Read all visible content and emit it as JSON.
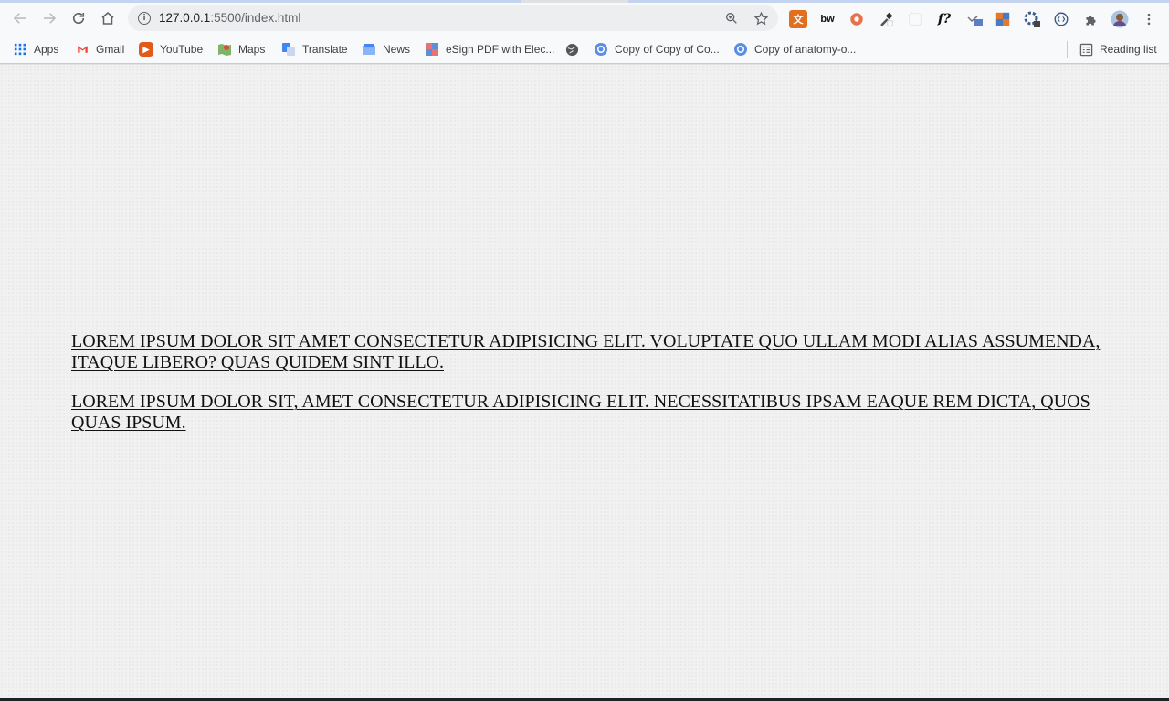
{
  "browser": {
    "url_host": "127.0.0.1",
    "url_rest": ":5500/index.html",
    "extensions": [
      "translate-ext-icon",
      "bw-ext-icon",
      "circle-ext-icon",
      "eyedropper-ext-icon",
      "blank-ext-icon",
      "font-ext-icon",
      "screenshot-ext-icon",
      "grid-ext-icon",
      "settings-ext-icon",
      "code-ext-icon",
      "puzzle-icon",
      "avatar",
      "more-menu-icon"
    ],
    "ext_labels": {
      "bw": "bw",
      "font": "f?"
    }
  },
  "bookmarks": {
    "items": [
      {
        "label": "Apps",
        "icon": "apps-grid-icon",
        "color": "#1a73e8"
      },
      {
        "label": "Gmail",
        "icon": "gmail-icon",
        "color": "#ea4335"
      },
      {
        "label": "YouTube",
        "icon": "youtube-icon",
        "color": "#ff0000"
      },
      {
        "label": "Maps",
        "icon": "maps-icon",
        "color": "#34a853"
      },
      {
        "label": "Translate",
        "icon": "translate-icon",
        "color": "#4285f4"
      },
      {
        "label": "News",
        "icon": "news-icon",
        "color": "#4285f4"
      },
      {
        "label": "eSign PDF with Elec...",
        "icon": "esign-icon",
        "color": "#e57373"
      },
      {
        "label": "",
        "icon": "globe-icon",
        "color": "#5f6368"
      },
      {
        "label": "Copy of Copy of Co...",
        "icon": "chrome-doc-icon",
        "color": "#4285f4"
      },
      {
        "label": "Copy of anatomy-o...",
        "icon": "chrome-doc-icon",
        "color": "#4285f4"
      }
    ],
    "reading_list": "Reading list"
  },
  "page": {
    "paragraphs": [
      "Lorem ipsum dolor sit amet consectetur adipisicing elit. Voluptate quo ullam modi alias assumenda, itaque libero? Quas quidem sint illo.",
      "Lorem ipsum dolor sit, amet consectetur adipisicing elit. Necessitatibus ipsam eaque rem dicta, quos quas ipsum."
    ]
  }
}
